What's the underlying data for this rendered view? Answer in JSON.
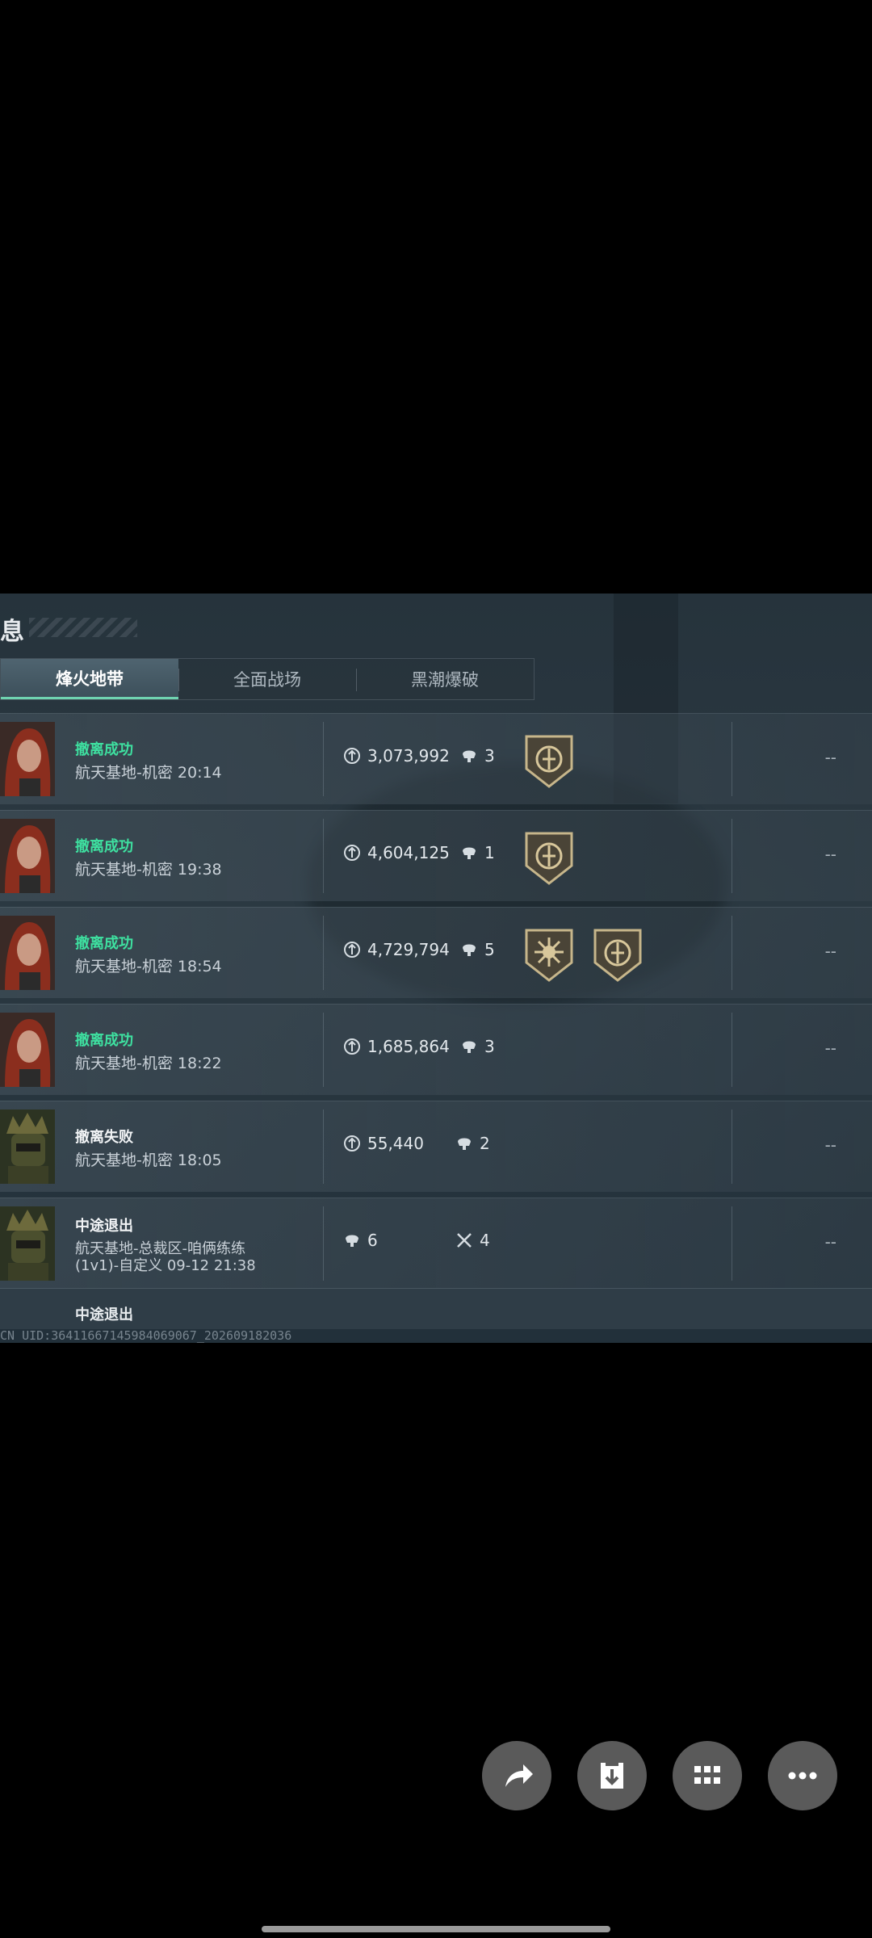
{
  "screen": {
    "title_fragment": "息"
  },
  "tabs": [
    {
      "label": "烽火地带",
      "active": true
    },
    {
      "label": "全面战场",
      "active": false
    },
    {
      "label": "黑潮爆破",
      "active": false
    }
  ],
  "records": [
    {
      "status": "撤离成功",
      "status_type": "success",
      "map_time": "航天基地-机密 20:14",
      "value": "3,073,992",
      "kills": "3",
      "badges": [
        "medal-icon"
      ],
      "right": "--"
    },
    {
      "status": "撤离成功",
      "status_type": "success",
      "map_time": "航天基地-机密 19:38",
      "value": "4,604,125",
      "kills": "1",
      "badges": [
        "medal-icon"
      ],
      "right": "--"
    },
    {
      "status": "撤离成功",
      "status_type": "success",
      "map_time": "航天基地-机密 18:54",
      "value": "4,729,794",
      "kills": "5",
      "badges": [
        "sun-medal-icon",
        "medal-icon"
      ],
      "right": "--"
    },
    {
      "status": "撤离成功",
      "status_type": "success",
      "map_time": "航天基地-机密 18:22",
      "value": "1,685,864",
      "kills": "3",
      "badges": [],
      "right": "--"
    },
    {
      "status": "撤离失败",
      "status_type": "neutral",
      "map_time": "航天基地-机密 18:05",
      "value": "55,440",
      "kills": "2",
      "badges": [],
      "right": "--"
    },
    {
      "status": "中途退出",
      "status_type": "neutral",
      "map_line1": "航天基地-总裁区-咱俩练练",
      "map_line2": "(1v1)-自定义 09-12 21:38",
      "kills": "6",
      "assists": "4",
      "right": "--"
    }
  ],
  "partial_row": {
    "status": "中途退出"
  },
  "uid": "CN UID:36411667145984069067_202609182036",
  "actions": [
    {
      "name": "share-icon"
    },
    {
      "name": "download-icon"
    },
    {
      "name": "apps-icon"
    },
    {
      "name": "more-icon"
    }
  ],
  "colors": {
    "success": "#3ee0a0",
    "accent_tab": "#6fd3b0"
  }
}
